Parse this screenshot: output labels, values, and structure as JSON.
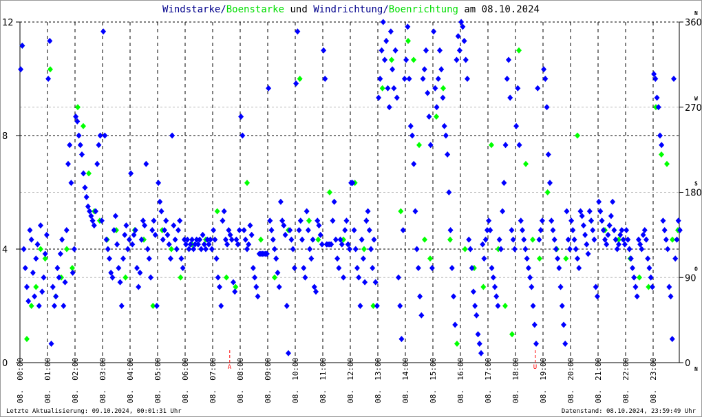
{
  "title": {
    "part1": "Windstarke",
    "sep1": "/",
    "part2": "Boenstarke",
    "mid": " und ",
    "part3": "Windrichtung",
    "sep2": "/",
    "part4": "Boenrichtung",
    "end": " am 08.10.2024"
  },
  "footer": {
    "left": "Letzte Aktualisierung: 09.10.2024, 00:01:31 Uhr",
    "right": "Datenstand: 08.10.2024, 23:59:49 Uhr"
  },
  "colors": {
    "wind": "#0000ff",
    "gust": "#00ff00",
    "marker": "#ff0000"
  },
  "chart_data": {
    "type": "scatter",
    "title": "Windstarke/Boenstarke und Windrichtung/Boenrichtung am 08.10.2024",
    "x_range_hours": [
      0,
      24
    ],
    "x_ticks": [
      "08. 00:00",
      "08. 01:00",
      "08. 02:00",
      "08. 03:00",
      "08. 04:00",
      "08. 05:00",
      "08. 06:00",
      "08. 07:00",
      "08. 08:00",
      "08. 09:00",
      "08. 10:00",
      "08. 11:00",
      "08. 12:00",
      "08. 13:00",
      "08. 14:00",
      "08. 15:00",
      "08. 16:00",
      "08. 17:00",
      "08. 18:00",
      "08. 19:00",
      "08. 20:00",
      "08. 21:00",
      "08. 22:00",
      "08. 23:00"
    ],
    "y_left": {
      "range": [
        0,
        12
      ],
      "ticks": [
        "0",
        "4",
        "8",
        "12"
      ]
    },
    "y_right": {
      "range": [
        0,
        360
      ],
      "ticks": [
        "0",
        "90",
        "180",
        "270",
        "360"
      ],
      "compass": [
        "N",
        "O",
        "S",
        "W",
        "N"
      ]
    },
    "annotations": [
      {
        "label": "A",
        "hour": 7.62
      },
      {
        "label": "U",
        "hour": 18.72
      }
    ],
    "series_note": "per hour: directions in degrees, evenly spaced within the hour",
    "wind_direction_by_hour": [
      [
        310,
        335,
        120,
        100,
        80,
        65,
        140,
        130,
        95,
        70,
        110,
        125,
        60,
        145,
        75,
        90,
        115,
        135
      ],
      [
        300,
        340,
        20,
        80,
        60,
        70,
        100,
        90,
        115,
        130,
        60,
        85,
        140,
        210,
        230,
        190,
        95,
        120
      ],
      [
        260,
        255,
        240,
        230,
        220,
        200,
        185,
        175,
        165,
        160,
        155,
        150,
        145,
        160,
        210,
        230,
        240,
        150
      ],
      [
        350,
        240,
        130,
        120,
        110,
        95,
        90,
        140,
        155,
        125,
        100,
        85,
        60,
        110,
        135,
        145,
        120,
        130
      ],
      [
        200,
        125,
        135,
        140,
        100,
        80,
        95,
        130,
        150,
        145,
        210,
        120,
        110,
        90,
        140,
        150,
        135,
        60
      ],
      [
        190,
        170,
        160,
        130,
        140,
        150,
        135,
        125,
        110,
        240,
        145,
        130,
        120,
        140,
        150,
        110,
        100,
        130
      ],
      [
        125,
        130,
        120,
        125,
        130,
        120,
        125,
        130,
        125,
        130,
        120,
        135,
        125,
        120,
        130,
        125,
        130,
        120
      ],
      [
        140,
        130,
        110,
        90,
        80,
        60,
        150,
        160,
        130,
        125,
        140,
        135,
        130,
        85,
        75,
        130,
        125,
        140
      ],
      [
        260,
        240,
        140,
        130,
        120,
        125,
        145,
        135,
        100,
        90,
        80,
        70,
        115,
        115,
        115,
        115,
        115,
        115
      ],
      [
        290,
        150,
        140,
        130,
        120,
        110,
        95,
        80,
        170,
        150,
        145,
        135,
        60,
        10,
        140,
        130,
        120,
        100
      ],
      [
        295,
        350,
        140,
        150,
        130,
        100,
        90,
        160,
        140,
        120,
        110,
        130,
        80,
        75,
        150,
        145,
        135,
        125
      ],
      [
        330,
        300,
        125,
        125,
        125,
        125,
        150,
        170,
        130,
        110,
        100,
        130,
        125,
        90,
        140,
        150,
        125,
        120
      ],
      [
        190,
        190,
        140,
        120,
        100,
        90,
        60,
        130,
        110,
        85,
        150,
        160,
        140,
        120,
        100,
        130,
        85,
        60
      ],
      [
        280,
        300,
        330,
        360,
        320,
        340,
        290,
        270,
        350,
        310,
        290,
        330,
        280,
        90,
        60,
        25,
        140,
        300
      ],
      [
        320,
        355,
        300,
        250,
        240,
        210,
        160,
        120,
        100,
        70,
        50,
        300,
        310,
        330,
        285,
        260,
        230,
        100
      ],
      [
        350,
        290,
        270,
        300,
        330,
        310,
        280,
        250,
        240,
        220,
        180,
        140,
        100,
        70,
        40,
        320,
        345,
        330
      ],
      [
        360,
        355,
        340,
        320,
        300,
        130,
        120,
        100,
        75,
        60,
        50,
        30,
        20,
        10,
        125,
        110,
        130,
        140
      ],
      [
        150,
        140,
        100,
        90,
        80,
        70,
        60,
        130,
        120,
        160,
        190,
        230,
        300,
        320,
        280,
        140,
        130,
        120
      ],
      [
        250,
        290,
        230,
        150,
        140,
        130,
        120,
        110,
        100,
        90,
        80,
        60,
        40,
        20,
        290,
        130,
        140,
        150
      ],
      [
        310,
        300,
        270,
        220,
        190,
        150,
        140,
        130,
        120,
        110,
        100,
        80,
        60,
        40,
        20,
        160,
        130,
        120
      ],
      [
        150,
        140,
        130,
        120,
        110,
        100,
        160,
        155,
        145,
        135,
        125,
        115,
        160,
        150,
        140,
        130,
        80,
        70
      ],
      [
        170,
        160,
        150,
        140,
        130,
        125,
        135,
        145,
        155,
        170,
        140,
        130,
        120,
        125,
        135,
        140,
        130,
        125
      ],
      [
        140,
        130,
        120,
        110,
        100,
        90,
        80,
        70,
        130,
        125,
        120,
        135,
        140,
        130,
        110,
        100,
        90,
        80
      ],
      [
        305,
        300,
        280,
        270,
        240,
        230,
        150,
        140,
        130,
        120,
        80,
        70,
        25,
        300,
        110,
        130,
        150,
        140
      ]
    ],
    "gust_direction_by_hour": [
      [
        335,
        25,
        60,
        80,
        120,
        110
      ],
      [
        310,
        70,
        90,
        120,
        100
      ],
      [
        270,
        250,
        200,
        160,
        150
      ],
      [
        130,
        140,
        90
      ],
      [
        140,
        130,
        60
      ],
      [
        140,
        120,
        90
      ],
      [
        125,
        130
      ],
      [
        160,
        90,
        80
      ],
      [
        190,
        130
      ],
      [
        90,
        140
      ],
      [
        300,
        150,
        130
      ],
      [
        180,
        130
      ],
      [
        190,
        120,
        60
      ],
      [
        290,
        320,
        160
      ],
      [
        340,
        320,
        230,
        130,
        110
      ],
      [
        260,
        290,
        130,
        20
      ],
      [
        120,
        100,
        80
      ],
      [
        230,
        120,
        60,
        30
      ],
      [
        330,
        210,
        130,
        110
      ],
      [
        180,
        120,
        110
      ],
      [
        240,
        150
      ],
      [
        140,
        130
      ],
      [
        110,
        90,
        80
      ],
      [
        270,
        220,
        210,
        130,
        140
      ]
    ]
  }
}
